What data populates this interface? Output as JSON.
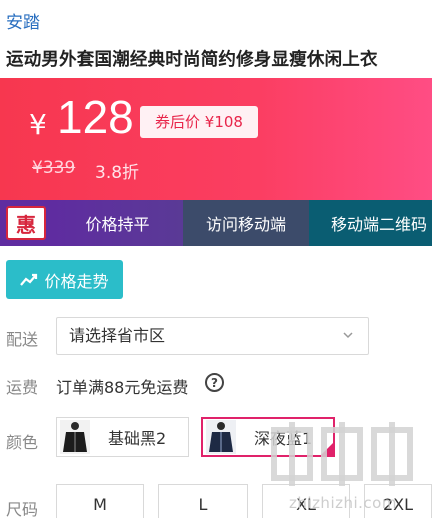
{
  "brand": "安踏",
  "product_title": "运动男外套国潮经典时尚简约修身显瘦休闲上衣",
  "price": {
    "currency": "¥",
    "current": "128",
    "coupon_label": "券后价 ¥108",
    "original": "¥339",
    "discount": "3.8折"
  },
  "promo": {
    "badge": "惠",
    "tabs": [
      "价格持平",
      "访问移动端",
      "移动端二维码"
    ]
  },
  "trend_button": "价格走势",
  "delivery": {
    "label": "配送",
    "placeholder": "请选择省市区"
  },
  "shipping": {
    "label": "运费",
    "text": "订单满88元免运费",
    "help": "?"
  },
  "color": {
    "label": "颜色",
    "options": [
      "基础黑2",
      "深夜蓝1"
    ],
    "selected_index": 1
  },
  "size": {
    "label": "尺码",
    "options": [
      "M",
      "L",
      "XL",
      "2XL"
    ]
  },
  "watermark": "zhizhizhi.com",
  "colors": {
    "accent_red": "#f7374f",
    "teal": "#2bbdc9",
    "purple": "#5f2ca0",
    "brand_blue": "#2a6fc0",
    "select_pink": "#e0226a"
  }
}
